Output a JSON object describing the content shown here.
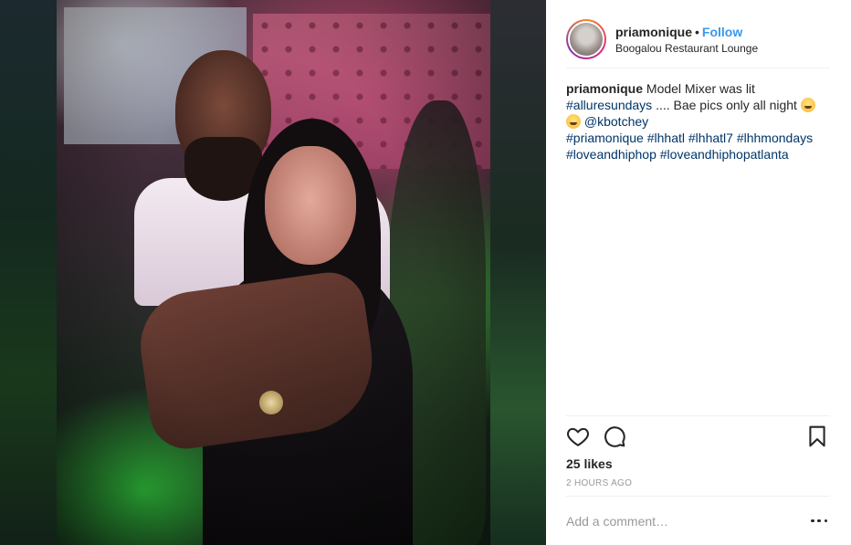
{
  "post": {
    "username": "priamonique",
    "separator": "•",
    "follow_label": "Follow",
    "location": "Boogalou Restaurant Lounge",
    "caption": {
      "username": "priamonique",
      "text_1": "Model Mixer was lit",
      "tag_1": "#alluresundays",
      "text_2": ".... Bae pics only all night",
      "mention": "@kbotchey",
      "hashtags": [
        "#priamonique",
        "#lhhatl",
        "#lhhatl7",
        "#lhhmondays",
        "#loveandhiphop",
        "#loveandhiphopatlanta"
      ]
    },
    "likes": "25 likes",
    "timestamp": "2 HOURS AGO",
    "comment_placeholder": "Add a comment…"
  },
  "icons": {
    "like": "heart-icon",
    "comment": "comment-bubble-icon",
    "save": "bookmark-icon",
    "more": "more-options-icon",
    "emoji": "smiling-face-emoji"
  },
  "colors": {
    "link_blue": "#3897f0",
    "hashtag_blue": "#003569",
    "text": "#262626",
    "muted": "#999999",
    "divider": "#efefef"
  }
}
